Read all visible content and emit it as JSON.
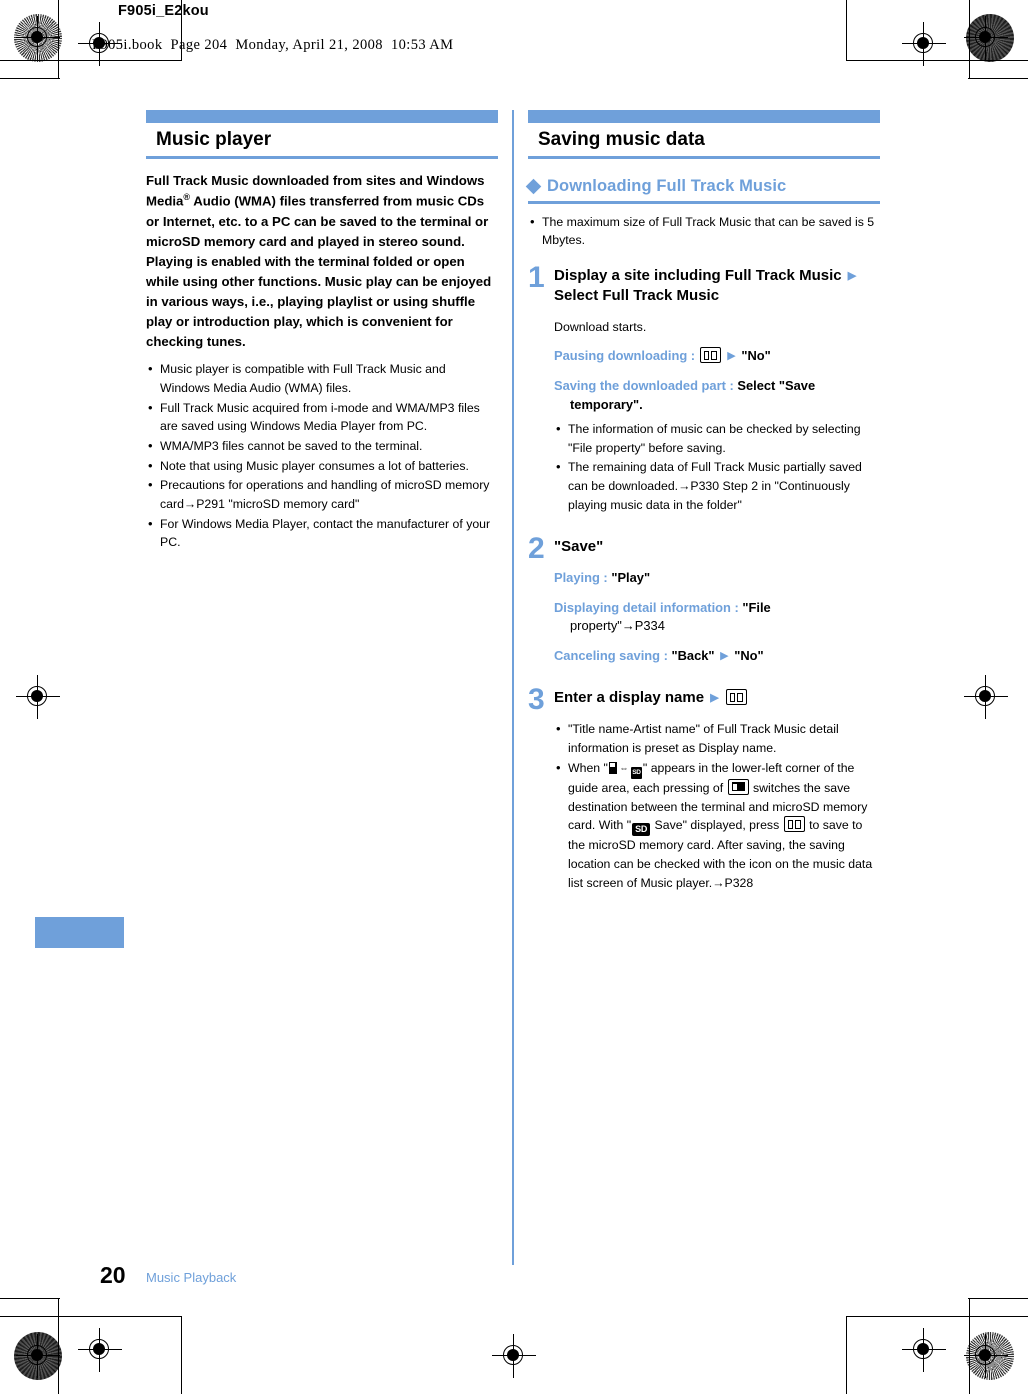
{
  "page_header": {
    "doc_code": "F905i_E2kou",
    "book_line": "F905i.book  Page 204  Monday, April 21, 2008  10:53 AM"
  },
  "colors": {
    "accent_blue": "#6fa0da",
    "text_black": "#000000"
  },
  "left_column": {
    "section": {
      "title": "Music player"
    },
    "lead_paragraph": "Full Track Music downloaded from sites and Windows Media® Audio (WMA) files transferred from music CDs or Internet, etc. to a PC can be saved to the terminal or microSD memory card and played in stereo sound. Playing is enabled with the terminal folded or open while using other functions. Music play can be enjoyed in various ways, i.e., playing playlist or using shuffle play or introduction play, which is convenient for checking tunes.",
    "bullets": [
      "Music player is compatible with Full Track Music and Windows Media Audio (WMA) files.",
      "Full Track Music acquired from i-mode and WMA/MP3 files are saved using Windows Media Player from PC.",
      "WMA/MP3 files cannot be saved to the terminal.",
      "Note that using Music player consumes a lot of batteries.",
      "Precautions for operations and handling of microSD memory card→P291 \"microSD memory card\"",
      "For Windows Media Player, contact the manufacturer of your PC."
    ]
  },
  "right_column": {
    "section": {
      "title": "Saving music data"
    },
    "subsection": {
      "title": "Downloading Full Track Music"
    },
    "intro_bullets": [
      "The maximum size of Full Track Music that can be saved is 5 Mbytes."
    ],
    "steps": [
      {
        "number": "1",
        "title_part1": "Display a site including Full Track Music",
        "title_part2": "Select Full Track Music",
        "plain_text": "Download starts.",
        "variants": [
          {
            "label": "Pausing downloading :",
            "icon": "book-key-icon",
            "arrow": "▶",
            "value": "\"No\""
          },
          {
            "label": "Saving the downloaded part :",
            "value": "Select \"Save",
            "value_cont": "temporary\"."
          }
        ],
        "bullets": [
          "The information of music can be checked by selecting \"File property\" before saving.",
          "The remaining data of Full Track Music partially saved can be downloaded.→P330 Step 2 in \"Continuously playing music data in the folder\""
        ]
      },
      {
        "number": "2",
        "title_part1": "\"Save\"",
        "variants": [
          {
            "label": "Playing :",
            "value": "\"Play\""
          },
          {
            "label": "Displaying detail information :",
            "value": "\"File",
            "value_cont": "property\"→P334"
          },
          {
            "label": "Canceling saving :",
            "value": "\"Back\"",
            "arrow": "▶",
            "value2": "\"No\""
          }
        ]
      },
      {
        "number": "3",
        "title_part1": "Enter a display name",
        "title_icon": "book-key-icon",
        "bullets": [
          "\"Title name-Artist name\" of Full Track Music detail information is preset as Display name.",
          "When \" ⟷ \" appears in the lower-left corner of the guide area, each pressing of  switches the save destination between the terminal and microSD memory card. With \" Save\" displayed, press  to save to the microSD memory card. After saving, the saving location can be checked with the icon on the music data list screen of Music player.→P328"
        ],
        "bullet2_parts": {
          "p1": "When \"",
          "p2": "\" appears in the lower-left corner of the guide area, each pressing of ",
          "p3": " switches the save destination between the terminal and microSD memory card. With \"",
          "p4": " Save\" displayed, press ",
          "p5": " to save to the microSD memory card. After saving, the saving location can be checked with the icon on the music data list screen of Music player.→P328"
        }
      }
    ]
  },
  "footer": {
    "page_number": "20",
    "chapter_label": "Music Playback"
  },
  "icons": {
    "sd_label": "SD",
    "sd_small_label": "SD",
    "swap_arrow": "⇔",
    "blue_triangle": "▶"
  }
}
